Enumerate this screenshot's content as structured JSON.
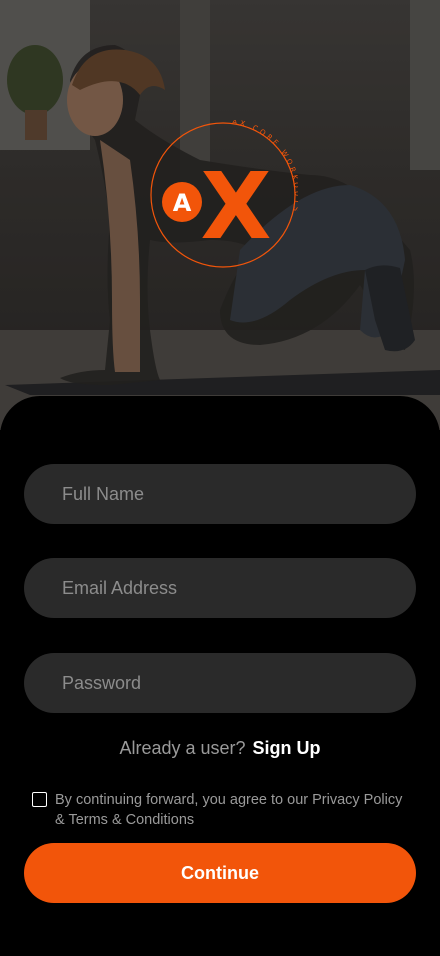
{
  "logo": {
    "badge_letter": "A",
    "main_letter": "X",
    "ring_text": "AX CORE WORKOUTS",
    "accent_color": "#F2550A"
  },
  "form": {
    "full_name_placeholder": "Full Name",
    "email_placeholder": "Email Address",
    "password_placeholder": "Password"
  },
  "signin": {
    "prompt": "Already a user?",
    "link_label": "Sign Up"
  },
  "terms": {
    "text": "By continuing forward, you agree to our Privacy Policy & Terms & Conditions",
    "checked": false
  },
  "actions": {
    "continue_label": "Continue"
  }
}
